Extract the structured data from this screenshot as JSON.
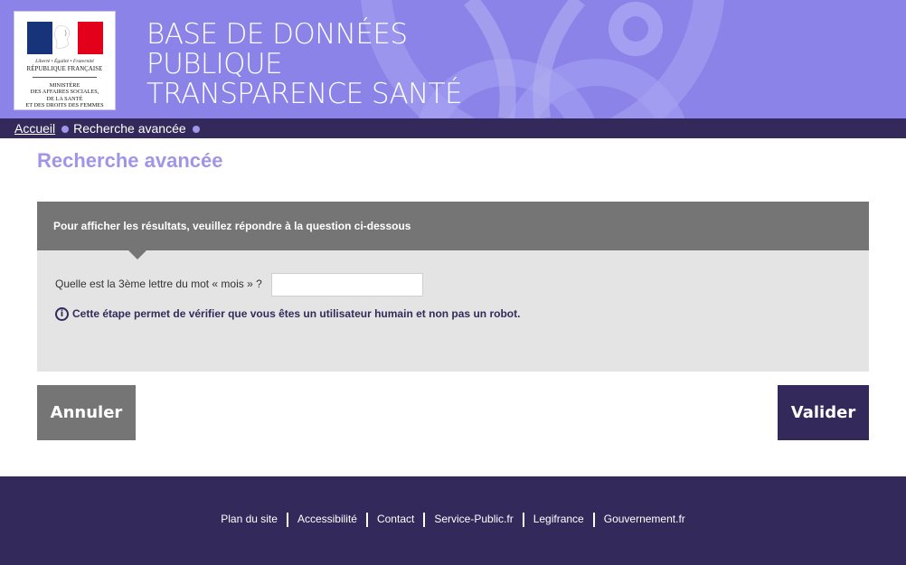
{
  "header": {
    "logo": {
      "motto": "Liberté • Égalité • Fraternité",
      "republic": "RÉPUBLIQUE FRANÇAISE",
      "ministry_lines": [
        "MINISTÈRE",
        "DES AFFAIRES SOCIALES,",
        "DE LA SANTÉ",
        "ET DES DROITS DES FEMMES"
      ]
    },
    "title_lines": [
      "BASE DE DONNÉES",
      "PUBLIQUE",
      "TRANSPARENCE SANTÉ"
    ]
  },
  "breadcrumb": {
    "home_label": "Accueil",
    "current_label": "Recherche avancée"
  },
  "page": {
    "title": "Recherche avancée"
  },
  "captcha": {
    "instruction": "Pour afficher les résultats, veuillez répondre à la question ci-dessous",
    "question": "Quelle est la 3ème lettre du mot « mois » ?",
    "answer_value": "",
    "info_icon": "info-icon",
    "info_text": "Cette étape permet de vérifier que vous êtes un utilisateur humain et non pas un robot."
  },
  "actions": {
    "cancel_label": "Annuler",
    "submit_label": "Valider"
  },
  "footer": {
    "links": [
      "Plan du site",
      "Accessibilité",
      "Contact",
      "Service-Public.fr",
      "Legifrance",
      "Gouvernement.fr"
    ]
  },
  "colors": {
    "header_bg": "#8b83e8",
    "dark_purple": "#332a5b",
    "title_purple": "#9f96e8",
    "panel_gray": "#757575",
    "panel_light": "#e4e4e4"
  }
}
